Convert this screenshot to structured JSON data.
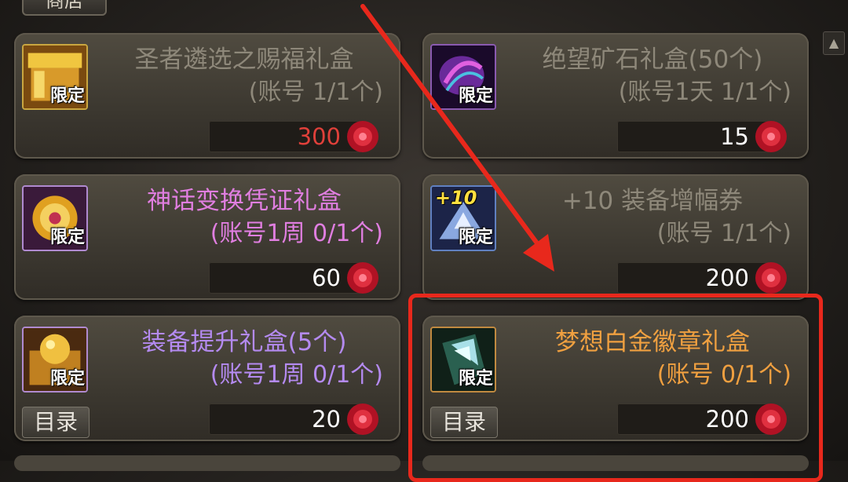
{
  "tab": {
    "label": "商店"
  },
  "currency_icon": "red-rose-gem-icon",
  "badge_text": "限定",
  "catalog_label": "目录",
  "items": [
    {
      "title": "圣者遴选之赐福礼盒",
      "subtitle": "(账号 1/1个)",
      "price": "300",
      "title_color": "#8e887a",
      "price_color": "#e0403a",
      "icon": "golden-treasure-chest-icon"
    },
    {
      "title": "绝望矿石礼盒(50个)",
      "subtitle": "(账号1天 1/1个)",
      "price": "15",
      "title_color": "#8e887a",
      "price_color": "#ffffff",
      "icon": "purple-ore-icon"
    },
    {
      "title": "神话变换凭证礼盒",
      "subtitle": "(账号1周 0/1个)",
      "price": "60",
      "title_color": "#e07ee0",
      "price_color": "#ffffff",
      "icon": "golden-medallion-icon"
    },
    {
      "title": "+10 装备增幅券",
      "subtitle": "(账号 1/1个)",
      "price": "200",
      "title_color": "#8e887a",
      "price_color": "#ffffff",
      "icon": "plus-ten-ticket-icon",
      "icon_overlay": "+10"
    },
    {
      "title": "装备提升礼盒(5个)",
      "subtitle": "(账号1周 0/1个)",
      "price": "20",
      "title_color": "#b48af0",
      "price_color": "#ffffff",
      "icon": "gold-orb-chest-icon"
    },
    {
      "title": "梦想白金徽章礼盒",
      "subtitle": "(账号 0/1个)",
      "price": "200",
      "title_color": "#f0a040",
      "price_color": "#ffffff",
      "icon": "platinum-crystal-icon"
    }
  ]
}
